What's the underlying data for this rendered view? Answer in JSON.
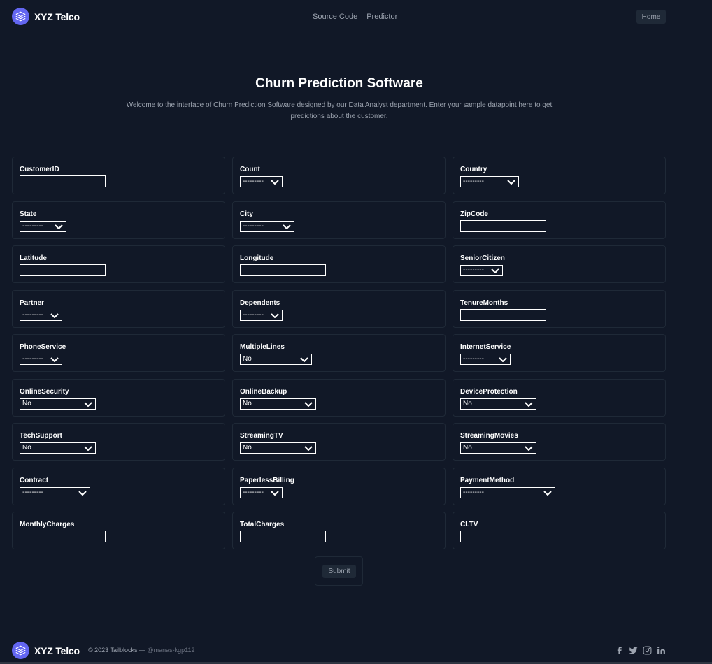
{
  "header": {
    "brand": "XYZ Telco",
    "nav": [
      {
        "label": "Source Code"
      },
      {
        "label": "Predictor"
      }
    ],
    "home_label": "Home"
  },
  "hero": {
    "title": "Churn Prediction Software",
    "description": "Welcome to the interface of Churn Prediction Software designed by our Data Analyst department. Enter your sample datapoint here to get predictions about the customer."
  },
  "form": {
    "fields": [
      {
        "label": "CustomerID",
        "type": "text",
        "value": ""
      },
      {
        "label": "Count",
        "type": "select",
        "value": "---------"
      },
      {
        "label": "Country",
        "type": "select",
        "value": "---------"
      },
      {
        "label": "State",
        "type": "select",
        "value": "---------"
      },
      {
        "label": "City",
        "type": "select",
        "value": "---------"
      },
      {
        "label": "ZipCode",
        "type": "text",
        "value": ""
      },
      {
        "label": "Latitude",
        "type": "text",
        "value": ""
      },
      {
        "label": "Longitude",
        "type": "text",
        "value": ""
      },
      {
        "label": "SeniorCitizen",
        "type": "select",
        "value": "---------"
      },
      {
        "label": "Partner",
        "type": "select",
        "value": "---------"
      },
      {
        "label": "Dependents",
        "type": "select",
        "value": "---------"
      },
      {
        "label": "TenureMonths",
        "type": "text",
        "value": ""
      },
      {
        "label": "PhoneService",
        "type": "select",
        "value": "---------"
      },
      {
        "label": "MultipleLines",
        "type": "select",
        "value": "No"
      },
      {
        "label": "InternetService",
        "type": "select",
        "value": "---------"
      },
      {
        "label": "OnlineSecurity",
        "type": "select",
        "value": "No"
      },
      {
        "label": "OnlineBackup",
        "type": "select",
        "value": "No"
      },
      {
        "label": "DeviceProtection",
        "type": "select",
        "value": "No"
      },
      {
        "label": "TechSupport",
        "type": "select",
        "value": "No"
      },
      {
        "label": "StreamingTV",
        "type": "select",
        "value": "No"
      },
      {
        "label": "StreamingMovies",
        "type": "select",
        "value": "No"
      },
      {
        "label": "Contract",
        "type": "select",
        "value": "---------"
      },
      {
        "label": "PaperlessBilling",
        "type": "select",
        "value": "---------"
      },
      {
        "label": "PaymentMethod",
        "type": "select",
        "value": "---------"
      },
      {
        "label": "MonthlyCharges",
        "type": "text",
        "value": ""
      },
      {
        "label": "TotalCharges",
        "type": "text",
        "value": ""
      },
      {
        "label": "CLTV",
        "type": "text",
        "value": ""
      }
    ],
    "submit_label": "Submit"
  },
  "footer": {
    "brand": "XYZ Telco",
    "copyright": "© 2023 Tailblocks —",
    "handle": "@manas-kgp112",
    "socials": [
      "facebook-icon",
      "twitter-icon",
      "instagram-icon",
      "linkedin-icon"
    ]
  },
  "colors": {
    "background": "#111827",
    "accent": "#6366f1",
    "card_border": "#1f2937",
    "text_muted": "#9ca3af"
  }
}
